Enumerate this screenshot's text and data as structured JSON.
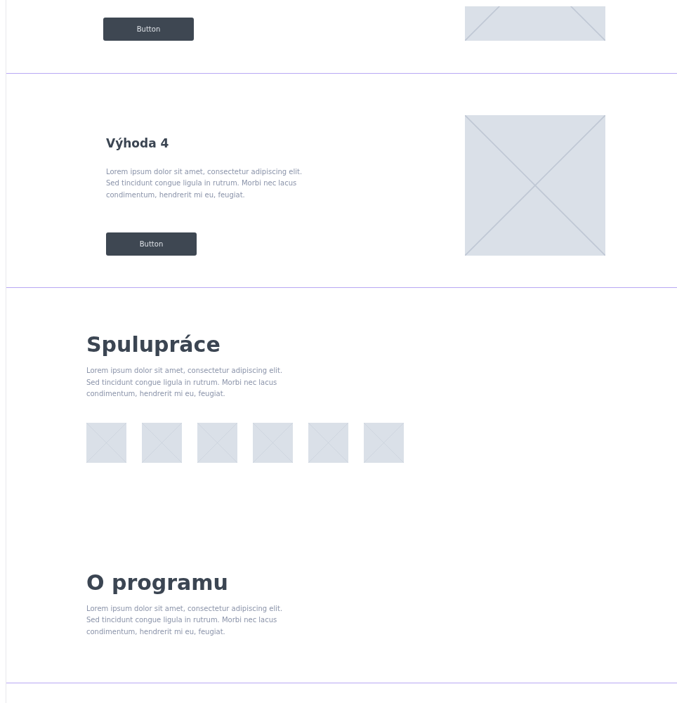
{
  "features": [
    {
      "cropped": true,
      "button": "Button"
    },
    {
      "cropped": false,
      "title": "Výhoda 4",
      "text": "Lorem ipsum dolor sit amet, consectetur adipiscing elit. Sed tincidunt congue ligula in rutrum. Morbi nec lacus condimentum, hendrerit mi eu, feugiat.",
      "button": "Button"
    }
  ],
  "partners": {
    "title": "Spulupráce",
    "text": "Lorem ipsum dolor sit amet, consectetur adipiscing elit. Sed tincidunt congue ligula in rutrum. Morbi nec lacus condimentum, hendrerit mi eu, feugiat."
  },
  "about": {
    "title": "O programu",
    "text": "Lorem ipsum dolor sit amet, consectetur adipiscing elit. Sed tincidunt congue ligula in rutrum. Morbi nec lacus condimentum, hendrerit mi eu, feugiat."
  }
}
